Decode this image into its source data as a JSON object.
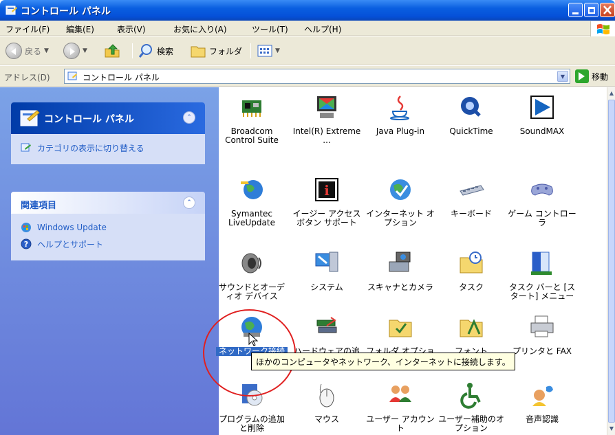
{
  "window": {
    "title": "コントロール パネル"
  },
  "menu": {
    "items": [
      "ファイル(F)",
      "編集(E)",
      "表示(V)",
      "お気に入り(A)",
      "ツール(T)",
      "ヘルプ(H)"
    ]
  },
  "toolbar": {
    "back_label": "戻る",
    "search_label": "検索",
    "folders_label": "フォルダ"
  },
  "address": {
    "label": "アドレス(D)",
    "value": "コントロール パネル",
    "go_label": "移動"
  },
  "taskpane": {
    "main_title": "コントロール パネル",
    "switch_view": "カテゴリの表示に切り替える",
    "related_title": "関連項目",
    "related_items": [
      "Windows Update",
      "ヘルプとサポート"
    ]
  },
  "icons": [
    {
      "label": "Broadcom Control Suite"
    },
    {
      "label": "Intel(R) Extreme ..."
    },
    {
      "label": "Java Plug-in"
    },
    {
      "label": "QuickTime"
    },
    {
      "label": "SoundMAX"
    },
    {
      "label": "Symantec LiveUpdate"
    },
    {
      "label": "イージー アクセス ボタン サポート"
    },
    {
      "label": "インターネット オプション"
    },
    {
      "label": "キーボード"
    },
    {
      "label": "ゲーム コントローラ"
    },
    {
      "label": "サウンドとオーディオ デバイス"
    },
    {
      "label": "システム"
    },
    {
      "label": "スキャナとカメラ"
    },
    {
      "label": "タスク"
    },
    {
      "label": "タスク バーと [スタート] メニュー"
    },
    {
      "label": "ネットワーク接続"
    },
    {
      "label": "ハードウェアの追加"
    },
    {
      "label": "フォルダ オプション"
    },
    {
      "label": "フォント"
    },
    {
      "label": "プリンタと FAX"
    },
    {
      "label": "プログラムの追加と削除"
    },
    {
      "label": "マウス"
    },
    {
      "label": "ユーザー アカウント"
    },
    {
      "label": "ユーザー補助のオプション"
    },
    {
      "label": "音声認識"
    }
  ],
  "tooltip": {
    "text": "ほかのコンピュータやネットワーク、インターネットに接続します。"
  }
}
